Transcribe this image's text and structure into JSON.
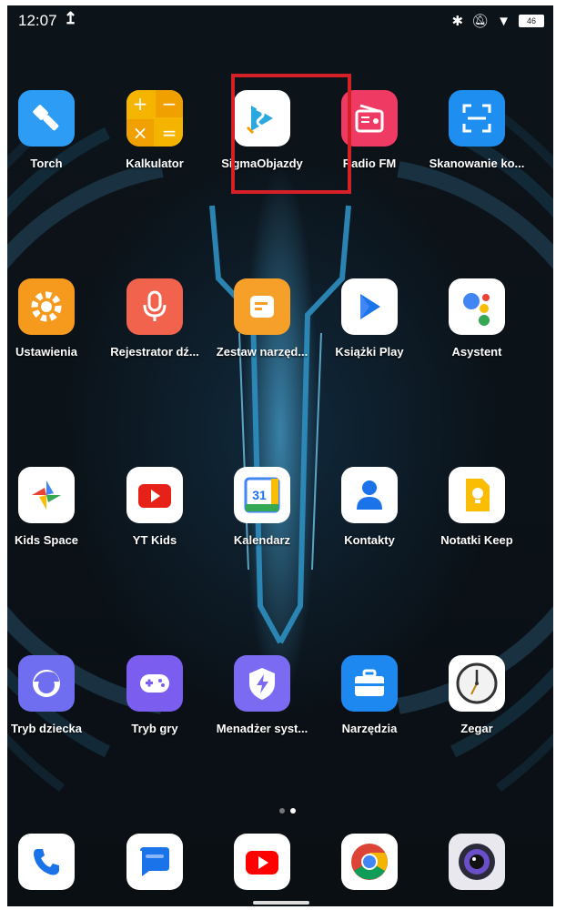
{
  "status": {
    "time": "12:07",
    "upload_icon": "↥",
    "battery": "46"
  },
  "apps": [
    {
      "name": "torch",
      "label": "Torch",
      "icon": "flashlight-icon",
      "color": "#2d9cf4"
    },
    {
      "name": "kalkulator",
      "label": "Kalkulator",
      "icon": "calculator-icon",
      "color": "#f5b400"
    },
    {
      "name": "sigmaobjazdy",
      "label": "SigmaObjazdy",
      "icon": "sigma-logo-icon",
      "color": "#ffffff"
    },
    {
      "name": "radio-fm",
      "label": "Radio FM",
      "icon": "radio-icon",
      "color": "#ef3a63"
    },
    {
      "name": "skanowanie",
      "label": "Skanowanie ko...",
      "icon": "scan-icon",
      "color": "#1e8ff0"
    },
    {
      "name": "ustawienia",
      "label": "Ustawienia",
      "icon": "gear-icon",
      "color": "#f59a1d"
    },
    {
      "name": "rejestrator",
      "label": "Rejestrator dź...",
      "icon": "microphone-icon",
      "color": "#f2634e"
    },
    {
      "name": "zestaw",
      "label": "Zestaw narzęd...",
      "icon": "sim-toolkit-icon",
      "color": "#f6a02a"
    },
    {
      "name": "ksiazki-play",
      "label": "Książki Play",
      "icon": "play-books-icon",
      "color": "#ffffff"
    },
    {
      "name": "asystent",
      "label": "Asystent",
      "icon": "assistant-icon",
      "color": "#ffffff"
    },
    {
      "name": "kids-space",
      "label": "Kids Space",
      "icon": "pinwheel-icon",
      "color": "#ffffff"
    },
    {
      "name": "yt-kids",
      "label": "YT Kids",
      "icon": "youtube-kids-icon",
      "color": "#ffffff"
    },
    {
      "name": "kalendarz",
      "label": "Kalendarz",
      "icon": "calendar-icon",
      "color": "#ffffff",
      "text": "31"
    },
    {
      "name": "kontakty",
      "label": "Kontakty",
      "icon": "contacts-icon",
      "color": "#ffffff"
    },
    {
      "name": "notatki-keep",
      "label": "Notatki Keep",
      "icon": "keep-icon",
      "color": "#ffffff"
    },
    {
      "name": "tryb-dziecka",
      "label": "Tryb dziecka",
      "icon": "child-face-icon",
      "color": "#6f6df0"
    },
    {
      "name": "tryb-gry",
      "label": "Tryb gry",
      "icon": "gamepad-icon",
      "color": "#7b5df0"
    },
    {
      "name": "menadzer",
      "label": "Menadżer syst...",
      "icon": "shield-bolt-icon",
      "color": "#7b6bf2"
    },
    {
      "name": "narzedzia",
      "label": "Narzędzia",
      "icon": "toolbox-icon",
      "color": "#1d88f0"
    },
    {
      "name": "zegar",
      "label": "Zegar",
      "icon": "clock-icon",
      "color": "#ffffff"
    }
  ],
  "dock": [
    {
      "name": "phone",
      "icon": "phone-icon"
    },
    {
      "name": "messages",
      "icon": "messages-icon"
    },
    {
      "name": "youtube",
      "icon": "youtube-icon"
    },
    {
      "name": "chrome",
      "icon": "chrome-icon"
    },
    {
      "name": "camera",
      "icon": "camera-icon"
    }
  ],
  "pager": {
    "pages": 2,
    "current": 2
  }
}
